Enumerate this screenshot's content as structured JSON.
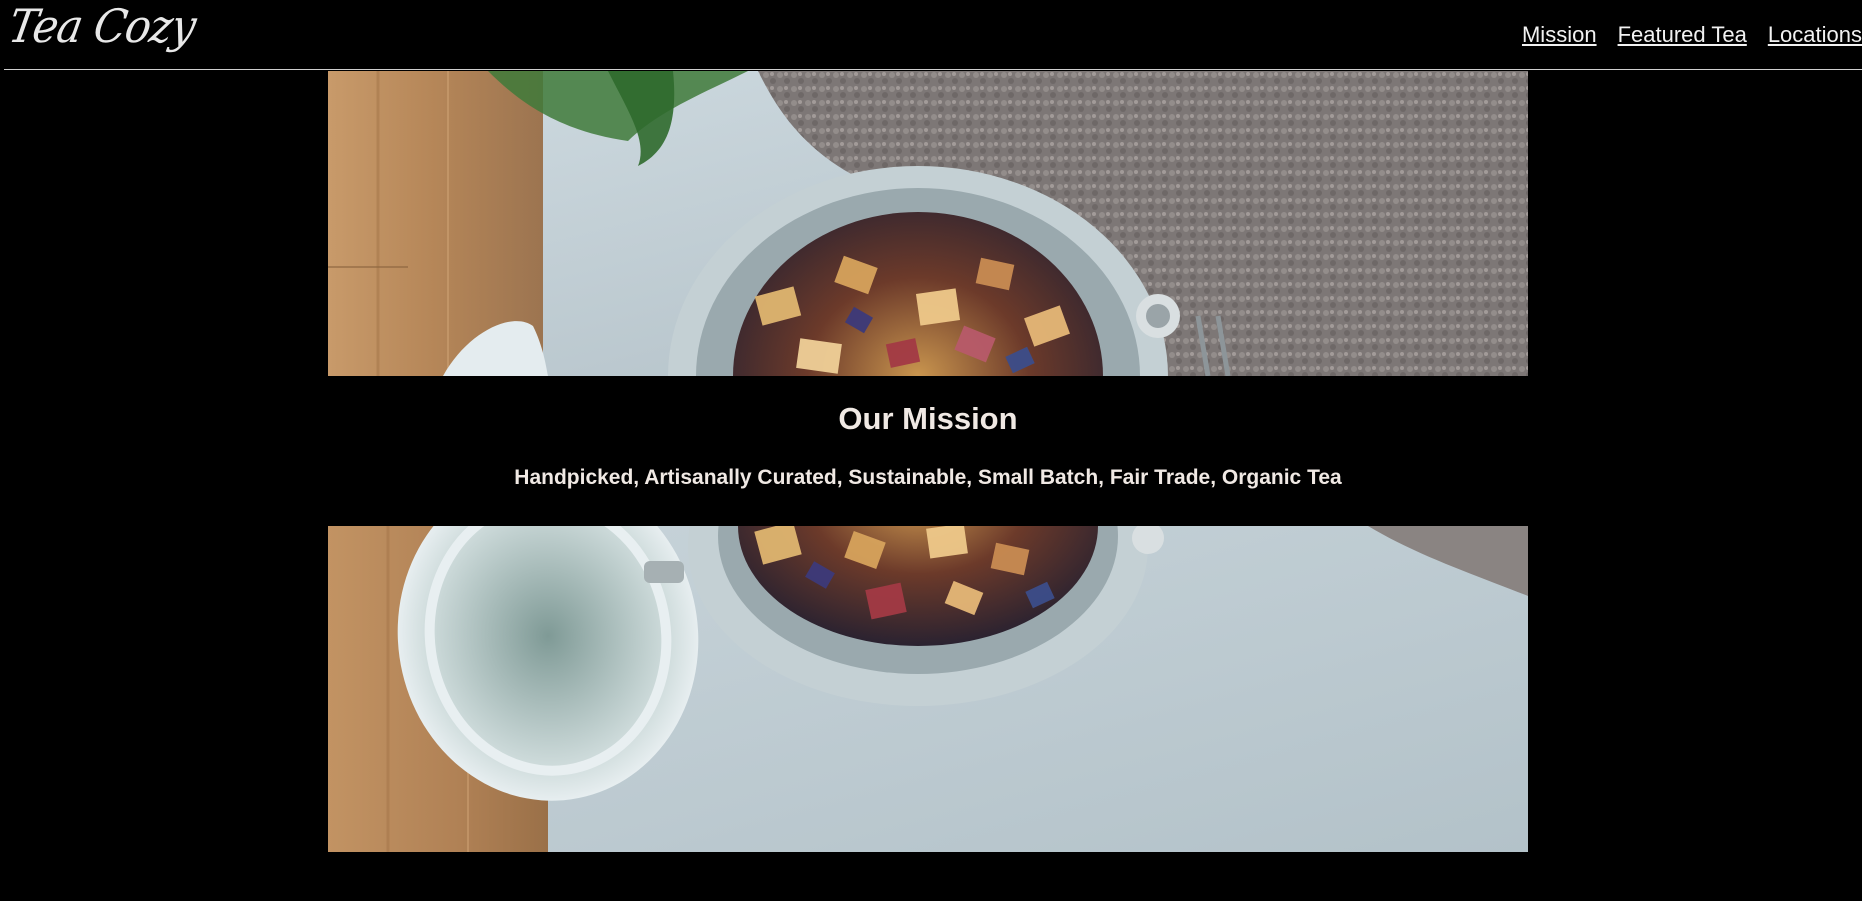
{
  "header": {
    "logo": "Tea Cozy",
    "nav": [
      "Mission",
      "Featured Tea",
      "Locations"
    ]
  },
  "mission": {
    "title": "Our Mission",
    "subtitle": "Handpicked, Artisanally Curated, Sustainable, Small Batch, Fair Trade, Organic Tea"
  },
  "colors": {
    "background": "#000000",
    "text": "#f0e9e4",
    "nav_text": "#f2f2f2",
    "wood": "#b88a5c",
    "tabletop": "#c3d1d9",
    "cloth": "#8a8684",
    "jar_rim": "#b9c5c9"
  }
}
